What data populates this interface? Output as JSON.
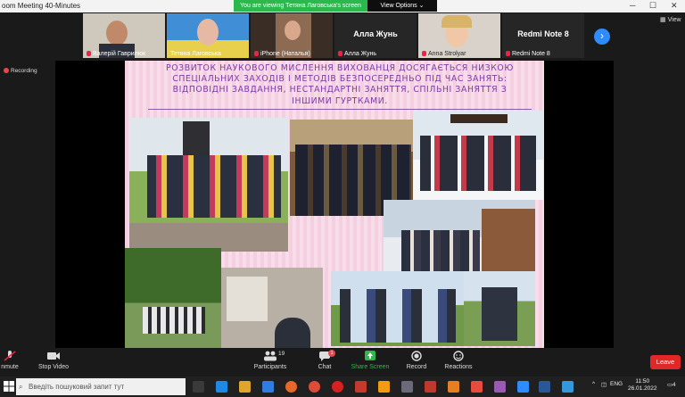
{
  "window": {
    "title": "oom Meeting 40-Minutes",
    "viewing_banner": "You are viewing Тетяна Лаговська's screen",
    "view_options": "View Options ⌄"
  },
  "gallery": {
    "participants": [
      {
        "name": "Валерій Гаврилюк",
        "muted": true
      },
      {
        "name": "Тетяна Лаговська",
        "muted": false
      },
      {
        "name": "iPhone (Наталья)",
        "muted": true
      },
      {
        "name": "Алла Жунь",
        "muted": true
      },
      {
        "name": "Anna Strolyar",
        "muted": true
      },
      {
        "name": "Redmi Note 8",
        "muted": true
      }
    ],
    "name_only_tiles": [
      "Алла Жунь",
      "Redmi Note 8"
    ],
    "view_label": "View"
  },
  "recording_label": "Recording",
  "slide": {
    "title_lines": [
      "РОЗВИТОК НАУКОВОГО МИСЛЕННЯ ВИХОВАНЦЯ ДОСЯГАЄТЬСЯ  НИЗКОЮ",
      "СПЕЦІАЛЬНИХ ЗАХОДІВ І МЕТОДІВ БЕЗПОСЕРЕДНЬО ПІД ЧАС ЗАНЯТЬ:",
      "ВІДПОВІДНІ ЗАВДАННЯ, НЕСТАНДАРТНІ ЗАНЯТТЯ, СПІЛЬНІ  ЗАНЯТТЯ З",
      "ІНШИМИ ГУРТКАМИ."
    ]
  },
  "toolbar": {
    "unmute": "nmute",
    "stop_video": "Stop Video",
    "participants": "Participants",
    "participants_count": "19",
    "chat": "Chat",
    "chat_badge": "1",
    "share_screen": "Share Screen",
    "record": "Record",
    "reactions": "Reactions",
    "leave": "Leave"
  },
  "taskbar": {
    "search_placeholder": "Введіть пошуковий запит тут",
    "language": "ENG",
    "time": "11:50",
    "date": "26.01.2022",
    "notification_count": "4"
  },
  "colors": {
    "accent": "#2d8cff",
    "banner": "#2db84d",
    "leave": "#e02828",
    "slide_title": "#7a3aa8"
  }
}
